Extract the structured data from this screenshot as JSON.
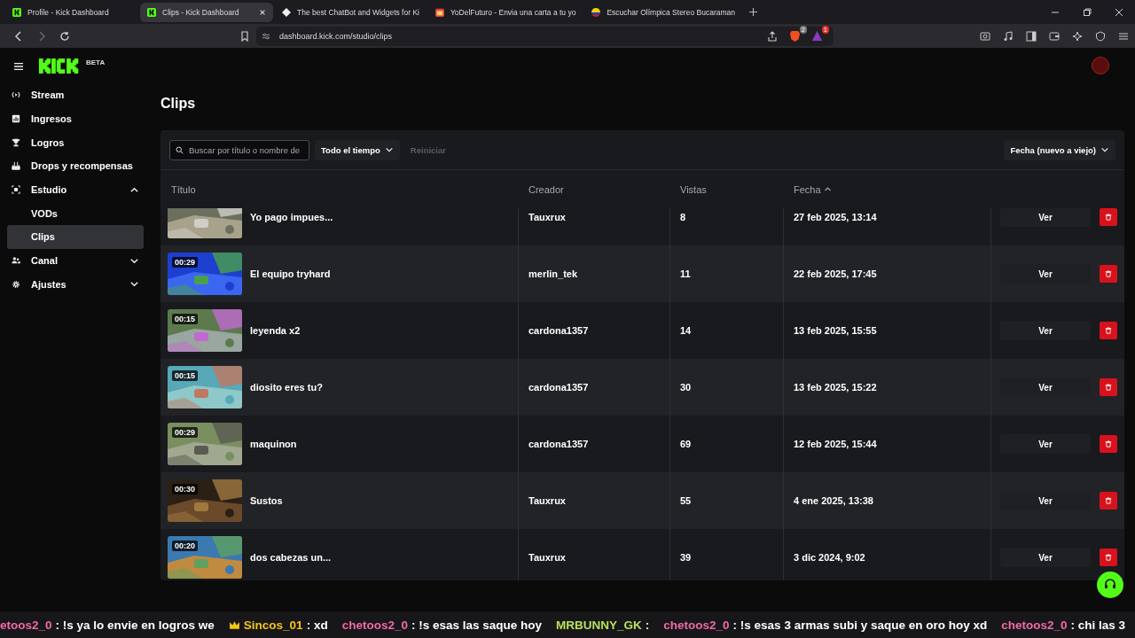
{
  "browser": {
    "tabs": [
      {
        "title": "Profile - Kick Dashboard",
        "selected": false
      },
      {
        "title": "Clips - Kick Dashboard",
        "selected": true
      },
      {
        "title": "The best ChatBot and Widgets for Ki",
        "selected": false
      },
      {
        "title": "YoDelFuturo - Envia una carta a tu yo",
        "selected": false
      },
      {
        "title": "Escuchar Olímpica Stereo Bucaraman",
        "selected": false
      }
    ],
    "url": "dashboard.kick.com/studio/clips",
    "badges": [
      {
        "count": "2"
      },
      {
        "count": "1"
      }
    ]
  },
  "sidebar": {
    "badge": "BETA",
    "items": [
      {
        "label": "Stream",
        "selected": false
      },
      {
        "label": "Ingresos",
        "selected": false
      },
      {
        "label": "Logros",
        "selected": false
      },
      {
        "label": "Drops y recompensas",
        "selected": false
      },
      {
        "label": "Estudio",
        "selected": false,
        "expanded": true,
        "children": [
          {
            "label": "VODs",
            "selected": false
          },
          {
            "label": "Clips",
            "selected": true
          }
        ]
      },
      {
        "label": "Canal",
        "selected": false,
        "expanded": false
      },
      {
        "label": "Ajustes",
        "selected": false,
        "expanded": false
      }
    ]
  },
  "page": {
    "title": "Clips"
  },
  "toolbar": {
    "search": {
      "placeholder": "Buscar por título o nombre de"
    },
    "period": "Todo el tiempo",
    "reset": {
      "label": "Reiniciar",
      "disabled": true
    },
    "sort": "Fecha (nuevo a viejo)"
  },
  "table": {
    "columns": [
      "Título",
      "Creador",
      "Vistas",
      "Fecha"
    ],
    "rows": [
      {
        "title": "Yo pago impues...",
        "creator": "Tauxrux",
        "views": "8",
        "date": "27 feb 2025, 13:14",
        "action": "Ver"
      },
      {
        "duration": "00:29",
        "title": "El equipo tryhard",
        "creator": "merlin_tek",
        "views": "11",
        "date": "22 feb 2025, 17:45",
        "action": "Ver"
      },
      {
        "duration": "00:15",
        "title": "leyenda x2",
        "creator": "cardona1357",
        "views": "14",
        "date": "13 feb 2025, 15:55",
        "action": "Ver"
      },
      {
        "duration": "00:15",
        "title": "diosito eres tu?",
        "creator": "cardona1357",
        "views": "30",
        "date": "13 feb 2025, 15:22",
        "action": "Ver"
      },
      {
        "duration": "00:29",
        "title": "maquinon",
        "creator": "cardona1357",
        "views": "69",
        "date": "12 feb 2025, 15:44",
        "action": "Ver"
      },
      {
        "duration": "00:30",
        "title": "Sustos",
        "creator": "Tauxrux",
        "views": "55",
        "date": "4 ene 2025, 13:38",
        "action": "Ver"
      },
      {
        "duration": "00:20",
        "title": "dos cabezas un...",
        "creator": "Tauxrux",
        "views": "39",
        "date": "3 dic 2024, 9:02",
        "action": "Ver"
      }
    ]
  },
  "chat_overlay": [
    {
      "user": "etoos2_0",
      "message": ": !s ya lo envie en logros we",
      "color": "#f06aa8"
    },
    {
      "user": "Sincos_01",
      "message": ": xd",
      "color": "#f5c518"
    },
    {
      "user": "chetoos2_0",
      "message": ": !s esas las saque hoy",
      "color": "#f06aa8"
    },
    {
      "user": "MRBUNNY_GK",
      "message": ":",
      "color": "#b8e05a"
    },
    {
      "user": "chetoos2_0",
      "message": ": !s esas 3 armas subi y saque en oro hoy xd",
      "color": "#f06aa8"
    },
    {
      "user": "chetoos2_0",
      "message": ": chi las 3",
      "color": "#f06aa8"
    }
  ]
}
